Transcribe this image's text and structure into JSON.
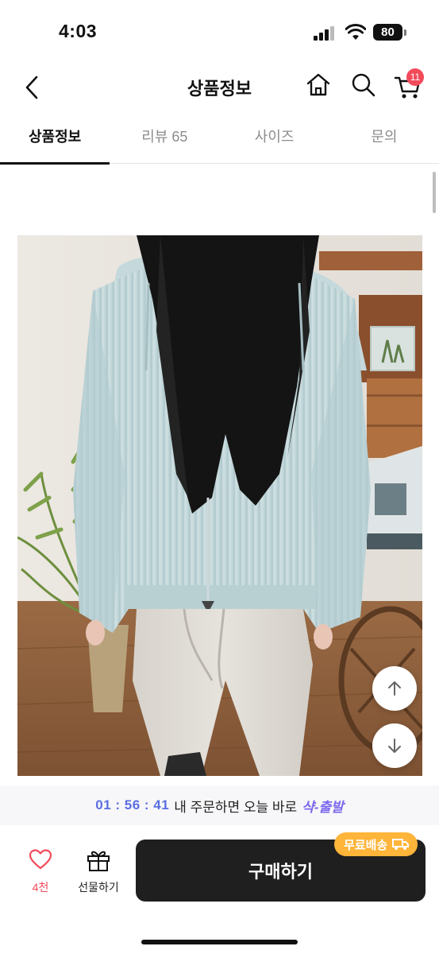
{
  "status_bar": {
    "time": "4:03",
    "battery": "80"
  },
  "header": {
    "title": "상품정보",
    "cart_count": "11"
  },
  "tabs": [
    {
      "label": "상품정보",
      "active": true
    },
    {
      "label": "리뷰 65",
      "active": false
    },
    {
      "label": "사이즈",
      "active": false
    },
    {
      "label": "문의",
      "active": false
    }
  ],
  "promo": {
    "countdown": "01 : 56 : 41",
    "message": "내 주문하면 오늘 바로",
    "highlight": "샥-출발"
  },
  "bottom_bar": {
    "like_count": "4천",
    "gift_label": "선물하기",
    "buy_label": "구매하기",
    "shipping_badge": "무료배송"
  },
  "colors": {
    "accent_red": "#f24b5b",
    "promo_blue": "#5b6ee1",
    "badge_orange": "#ffb43a",
    "buy_button": "#1f1f1f"
  }
}
